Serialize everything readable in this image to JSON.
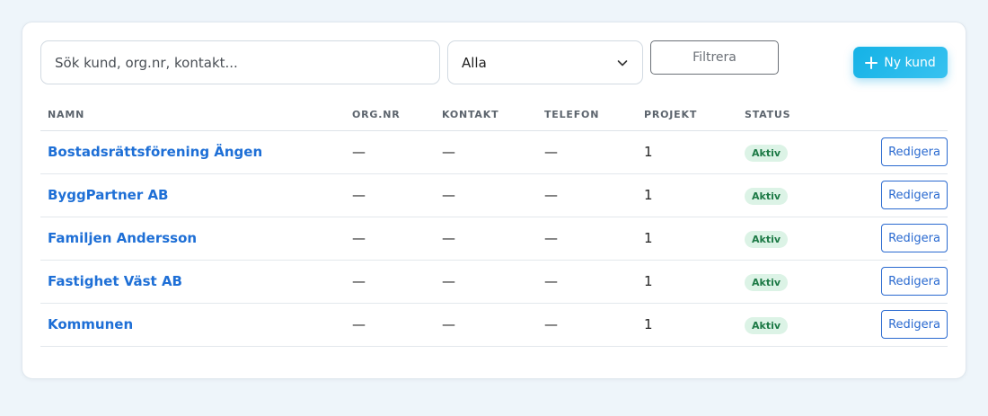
{
  "toolbar": {
    "search_placeholder": "Sök kund, org.nr, kontakt...",
    "status_filter_value": "Alla",
    "filter_label": "Filtrera",
    "new_customer_label": "Ny kund"
  },
  "table": {
    "columns": [
      "NAMN",
      "ORG.NR",
      "KONTAKT",
      "TELEFON",
      "PROJEKT",
      "STATUS"
    ],
    "rows": [
      {
        "name": "Bostadsrättsförening Ängen",
        "org_nr": "—",
        "contact": "—",
        "phone": "—",
        "projects": "1",
        "status": "Aktiv",
        "action": "Redigera"
      },
      {
        "name": "ByggPartner AB",
        "org_nr": "—",
        "contact": "—",
        "phone": "—",
        "projects": "1",
        "status": "Aktiv",
        "action": "Redigera"
      },
      {
        "name": "Familjen Andersson",
        "org_nr": "—",
        "contact": "—",
        "phone": "—",
        "projects": "1",
        "status": "Aktiv",
        "action": "Redigera"
      },
      {
        "name": "Fastighet Väst AB",
        "org_nr": "—",
        "contact": "—",
        "phone": "—",
        "projects": "1",
        "status": "Aktiv",
        "action": "Redigera"
      },
      {
        "name": "Kommunen",
        "org_nr": "—",
        "contact": "—",
        "phone": "—",
        "projects": "1",
        "status": "Aktiv",
        "action": "Redigera"
      }
    ]
  },
  "colors": {
    "accent": "#1e6fd6",
    "new_button": "#14b2e6",
    "status_active_bg": "#dcf3e6",
    "status_active_text": "#1d7a46"
  },
  "icons": {
    "select_indicator": "chevron-down-icon",
    "new_button": "plus-icon"
  }
}
